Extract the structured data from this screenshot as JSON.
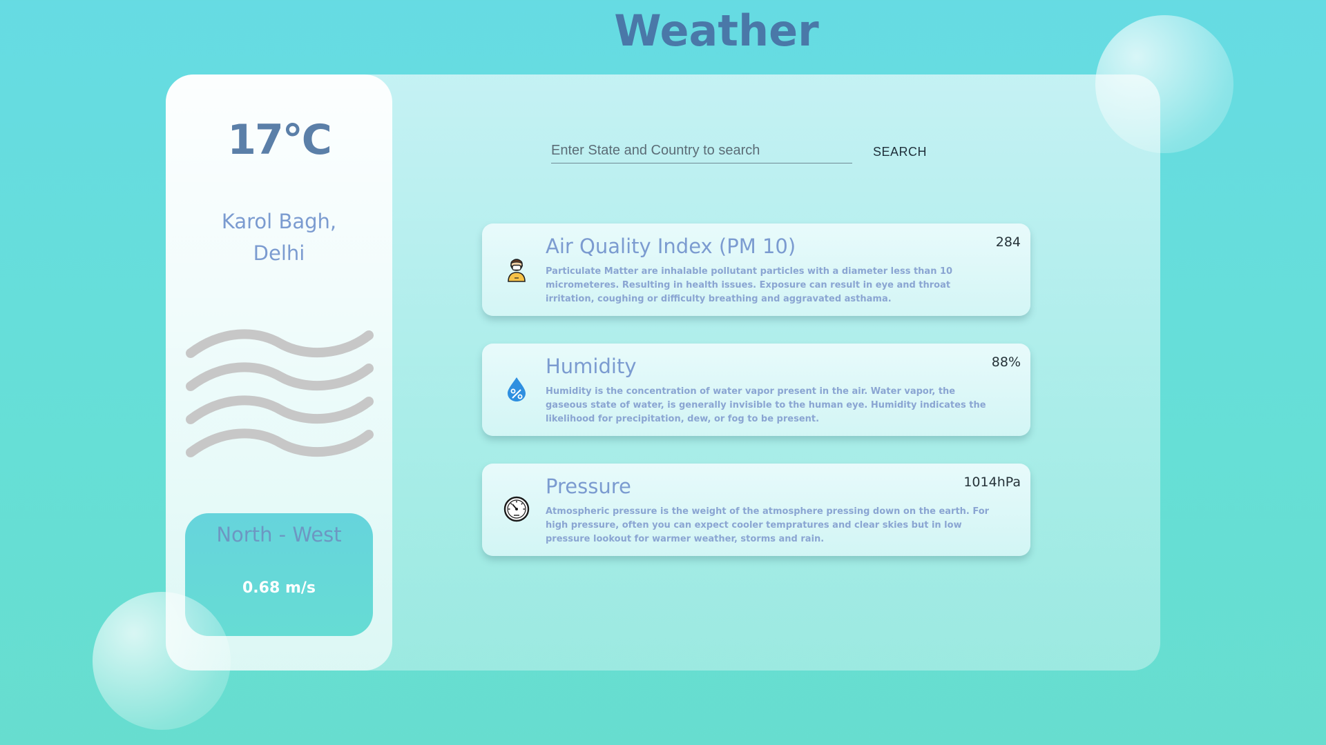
{
  "page": {
    "title": "Weather"
  },
  "current": {
    "temperature": "17°C",
    "location_line1": "Karol Bagh,",
    "location_line2": "Delhi",
    "wind_icon": "wind-icon",
    "wind_direction": "North - West",
    "wind_speed": "0.68 m/s"
  },
  "search": {
    "placeholder": "Enter State and Country to search",
    "value": "",
    "button_label": "SEARCH"
  },
  "metrics": [
    {
      "icon": "mask-person-icon",
      "title": "Air Quality Index (PM 10)",
      "value": "284",
      "description": "Particulate Matter are inhalable pollutant particles with a diameter less than 10 micrometeres. Resulting in health issues. Exposure can result in eye and throat irritation, coughing or difficulty breathing and aggravated asthama."
    },
    {
      "icon": "humidity-drop-icon",
      "title": "Humidity",
      "value": "88%",
      "description": "Humidity is the concentration of water vapor present in the air. Water vapor, the gaseous state of water, is generally invisible to the human eye. Humidity indicates the likelihood for precipitation, dew, or fog to be present."
    },
    {
      "icon": "pressure-gauge-icon",
      "title": "Pressure",
      "value": "1014hPa",
      "description": "Atmospheric pressure is the weight of the atmosphere pressing down on the earth. For high pressure, often you can expect cooler tempratures and clear skies but in low pressure lookout for warmer weather, storms and rain."
    }
  ],
  "colors": {
    "accent": "#4a78a8",
    "text_soft": "#7b9bd0",
    "humidity_blue": "#2f8fe0"
  }
}
